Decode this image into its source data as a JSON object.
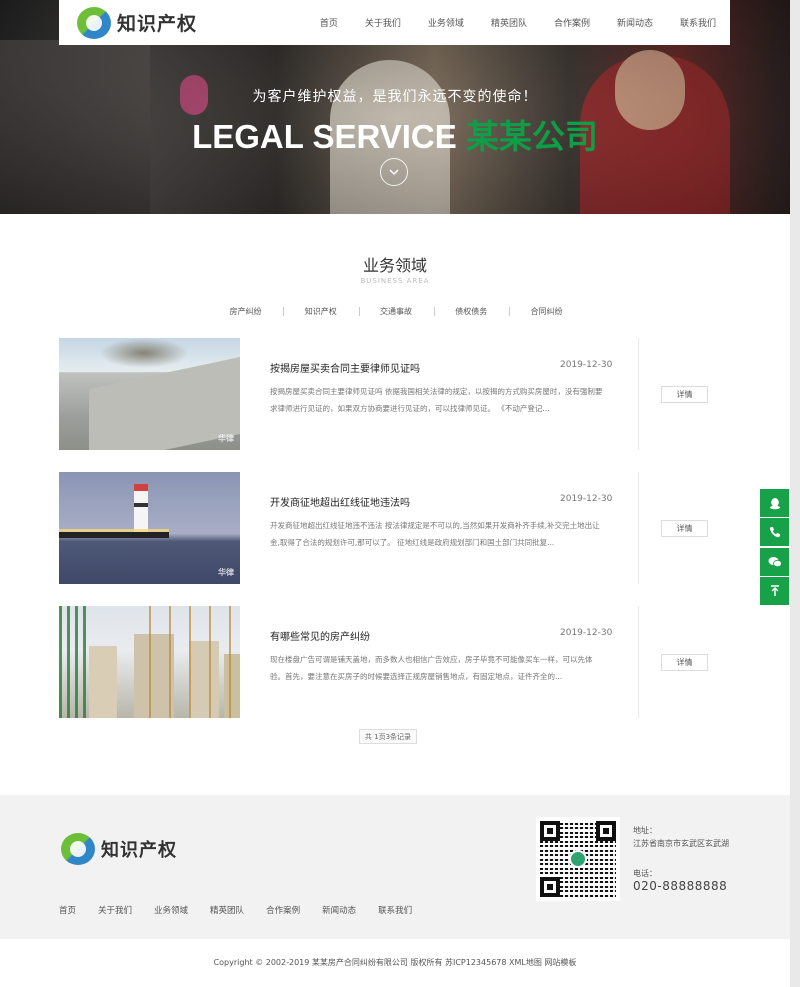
{
  "nav": {
    "logo_text": "知识产权",
    "links": [
      "首页",
      "关于我们",
      "业务领域",
      "精英团队",
      "合作案例",
      "新闻动态",
      "联系我们"
    ]
  },
  "hero": {
    "subtitle": "为客户维护权益，是我们永远不变的使命！",
    "title_main": "LEGAL SERVICE",
    "title_accent": "某某公司",
    "down_icon": "chevron-down-icon"
  },
  "section": {
    "title": "业务领域",
    "subtitle": "BUSINESS AREA",
    "tabs": [
      "房产纠纷",
      "知识产权",
      "交通事故",
      "债权债务",
      "合同纠纷"
    ]
  },
  "items": [
    {
      "title": "按揭房屋买卖合同主要律师见证吗",
      "date": "2019-12-30",
      "desc": "按揭房屋买卖合同主要律师见证吗 依据我国相关法律的规定，以按揭的方式购买房屋时，没有强制要求律师进行见证的，如果双方协商要进行见证的，可以找律师见证。 《不动产登记...",
      "button": "详情",
      "watermark": "华律"
    },
    {
      "title": "开发商征地超出红线征地违法吗",
      "date": "2019-12-30",
      "desc": "开发商征地超出红线征地违不违法 按法律规定是不可以的,当然如果开发商补齐手续,补交完土地出让金,取得了合法的规划许可,那可以了。 征地红线是政府规划部门和国土部门共同批复...",
      "button": "详情",
      "watermark": "华律"
    },
    {
      "title": "有哪些常见的房产纠纷",
      "date": "2019-12-30",
      "desc": "现在楼盘广告可谓是铺天盖地，而多数人也相信广告效应，房子毕竟不可能像买车一样，可以先体验。首先，要注意在买房子的时候要选择正规房屋销售地点，有固定地点，证件齐全的...",
      "button": "详情",
      "watermark": ""
    }
  ],
  "pager": "共 1页3条记录",
  "float_icons": [
    "qq-icon",
    "phone-icon",
    "wechat-icon",
    "back-to-top-icon"
  ],
  "footer": {
    "logo_text": "知识产权",
    "nav": [
      "首页",
      "关于我们",
      "业务领域",
      "精英团队",
      "合作案例",
      "新闻动态",
      "联系我们"
    ],
    "address_label": "地址：",
    "address": "江苏省南京市玄武区玄武湖",
    "tel_label": "电话：",
    "tel": "020-88888888",
    "copyright": "Copyright © 2002-2019 某某房产合同纠纷有限公司 版权所有 苏ICP12345678 XML地图 网站模板"
  },
  "colors": {
    "accent": "#0d9e47",
    "float_bg": "#17a148",
    "footer_bg": "#f2f2f2"
  }
}
